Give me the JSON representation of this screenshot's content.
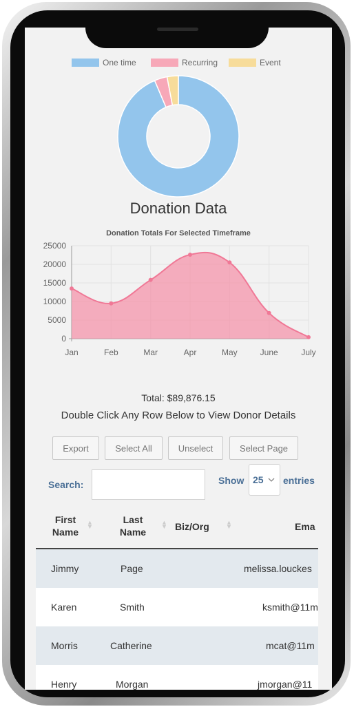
{
  "legend": [
    {
      "label": "One time",
      "color": "#93c5ec"
    },
    {
      "label": "Recurring",
      "color": "#f7a8b8"
    },
    {
      "label": "Event",
      "color": "#f7dc9a"
    }
  ],
  "donut": {
    "slices": [
      {
        "label": "One time",
        "value": 93.6,
        "color": "#93c5ec"
      },
      {
        "label": "Recurring",
        "value": 3.4,
        "color": "#f7a8b8"
      },
      {
        "label": "Event",
        "value": 3.0,
        "color": "#f7dc9a"
      }
    ]
  },
  "page_title": "Donation Data",
  "chart_data": {
    "type": "area",
    "title": "Donation Totals For Selected Timeframe",
    "categories": [
      "Jan",
      "Feb",
      "Mar",
      "Apr",
      "May",
      "June",
      "July"
    ],
    "values": [
      13500,
      9500,
      15800,
      22600,
      20500,
      6900,
      400
    ],
    "ylim": [
      0,
      25000
    ],
    "y_ticks": [
      "25000",
      "20000",
      "15000",
      "10000",
      "5000",
      "0"
    ],
    "color": "#f58ea6",
    "grid": true
  },
  "summary": {
    "total": "Total: $89,876.15",
    "instruction": "Double Click Any Row Below to View Donor Details"
  },
  "buttons": {
    "export": "Export",
    "select_all": "Select All",
    "unselect": "Unselect",
    "select_page": "Select Page"
  },
  "search": {
    "label": "Search:",
    "value": ""
  },
  "length": {
    "show": "Show",
    "value": "25",
    "entries": "entries"
  },
  "table": {
    "headers": [
      {
        "line1": "First",
        "line2": "Name"
      },
      {
        "line1": "Last",
        "line2": "Name"
      },
      {
        "line1": "Biz/Org",
        "line2": ""
      },
      {
        "line1": "Ema",
        "line2": ""
      }
    ],
    "rows": [
      {
        "first": "Jimmy",
        "last": "Page",
        "org": "",
        "email": "melissa.louckes"
      },
      {
        "first": "Karen",
        "last": "Smith",
        "org": "",
        "email": "ksmith@11m"
      },
      {
        "first": "Morris",
        "last": "Catherine",
        "org": "",
        "email": "mcat@11m"
      },
      {
        "first": "Henry",
        "last": "Morgan",
        "org": "",
        "email": "jmorgan@11"
      }
    ]
  }
}
